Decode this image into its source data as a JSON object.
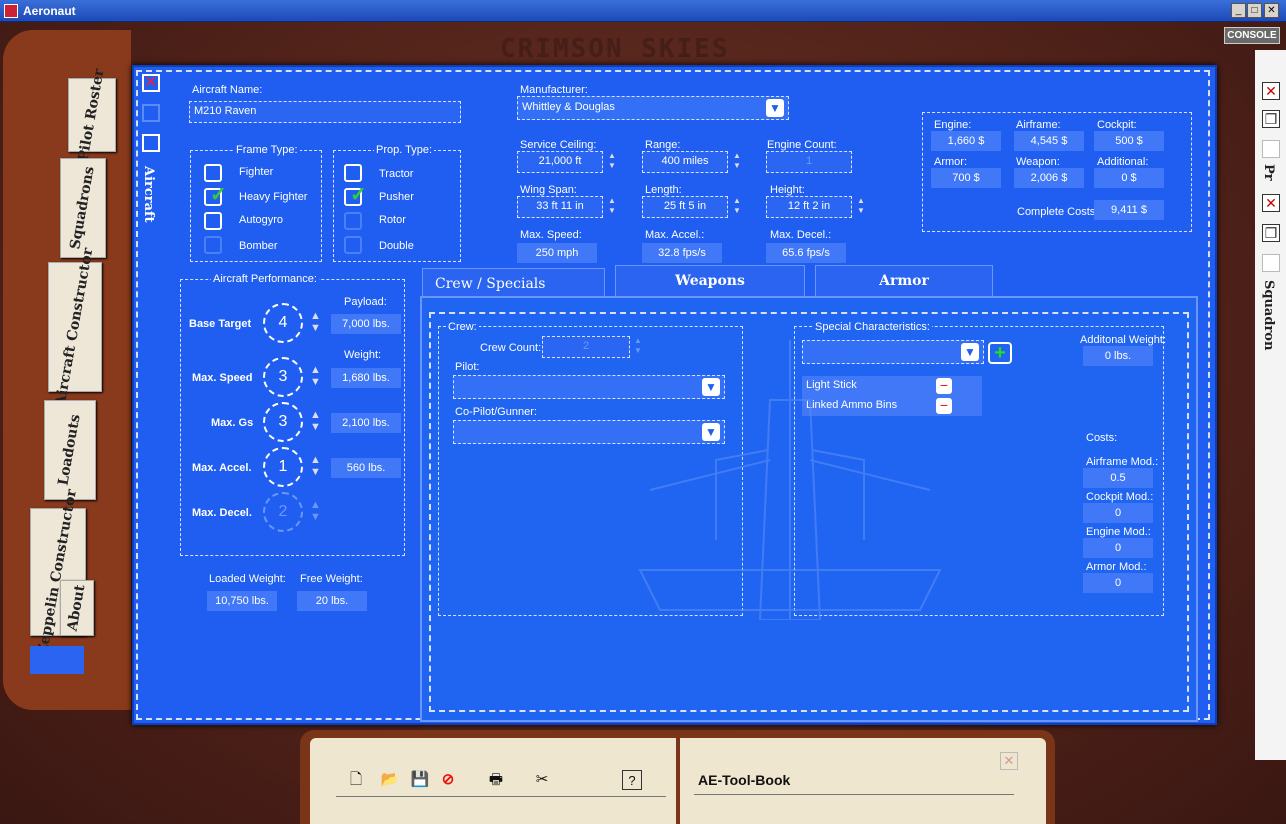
{
  "window": {
    "title": "Aeronaut",
    "console": "CONSOLE"
  },
  "logo": "CRIMSON SKIES",
  "folder_tabs": [
    "Pilot Roster",
    "Squadrons",
    "Aircraft Constructor",
    "Loadouts",
    "Zeppelin Constructor",
    "About"
  ],
  "side_label": "Aircraft",
  "right_panel": {
    "label1": "Pr",
    "label2": "Squadron"
  },
  "aircraft_name": {
    "label": "Aircraft Name:",
    "value": "M210 Raven"
  },
  "manufacturer": {
    "label": "Manufacturer:",
    "value": "Whittley & Douglas"
  },
  "frame_type": {
    "label": "Frame Type:",
    "options": [
      {
        "label": "Fighter",
        "checked": false
      },
      {
        "label": "Heavy Fighter",
        "checked": true
      },
      {
        "label": "Autogyro",
        "checked": false
      },
      {
        "label": "Bomber",
        "checked": false
      }
    ]
  },
  "prop_type": {
    "label": "Prop. Type:",
    "options": [
      {
        "label": "Tractor",
        "checked": false
      },
      {
        "label": "Pusher",
        "checked": true
      },
      {
        "label": "Rotor",
        "checked": false
      },
      {
        "label": "Double",
        "checked": false
      }
    ]
  },
  "specs": {
    "service_ceiling": {
      "label": "Service Ceiling:",
      "value": "21,000 ft"
    },
    "range": {
      "label": "Range:",
      "value": "400 miles"
    },
    "engine_count": {
      "label": "Engine Count:",
      "value": "1"
    },
    "wing_span": {
      "label": "Wing Span:",
      "value": "33 ft 11 in"
    },
    "length": {
      "label": "Length:",
      "value": "25 ft 5 in"
    },
    "height": {
      "label": "Height:",
      "value": "12 ft 2 in"
    },
    "max_speed": {
      "label": "Max. Speed:",
      "value": "250 mph"
    },
    "max_accel": {
      "label": "Max. Accel.:",
      "value": "32.8 fps/s"
    },
    "max_decel": {
      "label": "Max. Decel.:",
      "value": "65.6 fps/s"
    }
  },
  "costs": {
    "engine": {
      "label": "Engine:",
      "value": "1,660 $"
    },
    "airframe": {
      "label": "Airframe:",
      "value": "4,545 $"
    },
    "cockpit": {
      "label": "Cockpit:",
      "value": "500 $"
    },
    "armor": {
      "label": "Armor:",
      "value": "700 $"
    },
    "weapon": {
      "label": "Weapon:",
      "value": "2,006 $"
    },
    "additional": {
      "label": "Additional:",
      "value": "0 $"
    },
    "complete": {
      "label": "Complete Costs:",
      "value": "9,411 $"
    }
  },
  "performance": {
    "label": "Aircraft Performance:",
    "rows": [
      {
        "label": "Base Target",
        "value": "4",
        "weight_label": "Payload:",
        "weight": "7,000 lbs."
      },
      {
        "label": "Max. Speed",
        "value": "3",
        "weight_label": "Weight:",
        "weight": "1,680 lbs."
      },
      {
        "label": "Max. Gs",
        "value": "3",
        "weight": "2,100 lbs."
      },
      {
        "label": "Max. Accel.",
        "value": "1",
        "weight": "560 lbs."
      },
      {
        "label": "Max. Decel.",
        "value": "2"
      }
    ],
    "loaded_weight": {
      "label": "Loaded Weight:",
      "value": "10,750 lbs."
    },
    "free_weight": {
      "label": "Free Weight:",
      "value": "20 lbs."
    }
  },
  "tabs": [
    "Crew / Specials",
    "Weapons",
    "Armor"
  ],
  "crew": {
    "label": "Crew:",
    "count_label": "Crew Count:",
    "count": "2",
    "pilot_label": "Pilot:",
    "copilot_label": "Co-Pilot/Gunner:"
  },
  "specials": {
    "label": "Special Characteristics:",
    "items": [
      "Light Stick",
      "Linked Ammo Bins"
    ],
    "add_weight_label": "Additonal Weight:",
    "add_weight": "0 lbs."
  },
  "mod_costs": {
    "label": "Costs:",
    "airframe": {
      "label": "Airframe Mod.:",
      "value": "0.5"
    },
    "cockpit": {
      "label": "Cockpit Mod.:",
      "value": "0"
    },
    "engine": {
      "label": "Engine Mod.:",
      "value": "0"
    },
    "armor": {
      "label": "Armor Mod.:",
      "value": "0"
    }
  },
  "toolbook": {
    "title": "AE-Tool-Book"
  }
}
